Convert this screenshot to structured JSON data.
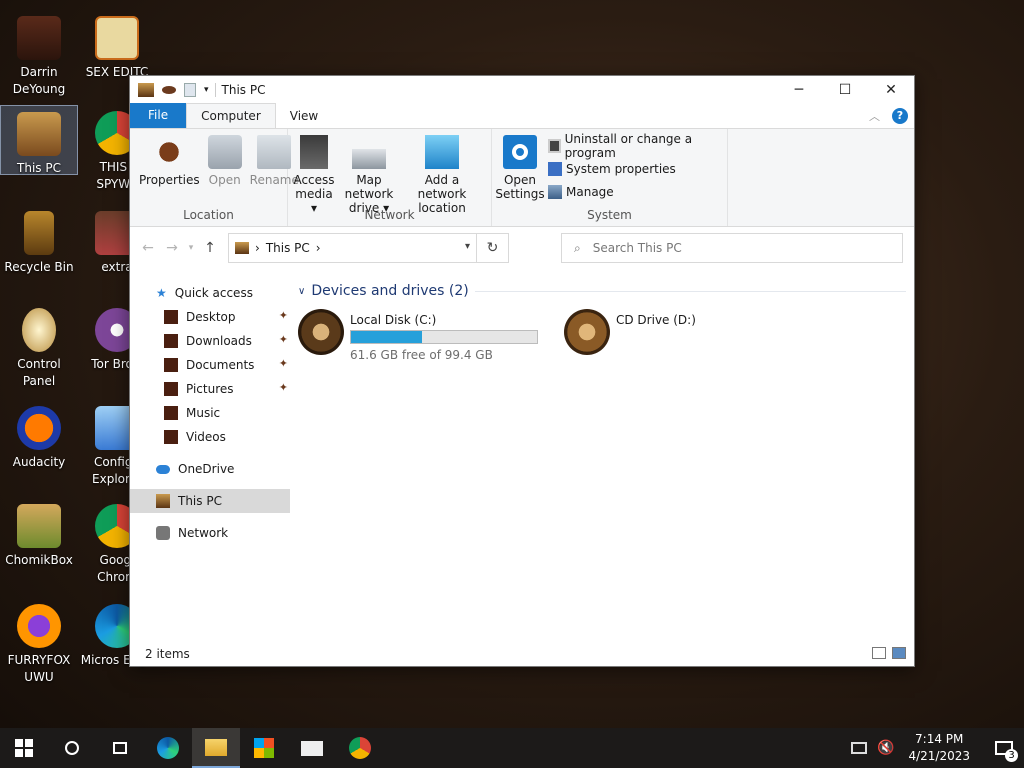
{
  "desktop": {
    "icons": [
      {
        "label": "Darrin DeYoung"
      },
      {
        "label": "SEX EDITC"
      },
      {
        "label": "This PC"
      },
      {
        "label": "THIS I SPYWA"
      },
      {
        "label": "Recycle Bin"
      },
      {
        "label": "extra"
      },
      {
        "label": "Control Panel"
      },
      {
        "label": "Tor Brow"
      },
      {
        "label": "Audacity"
      },
      {
        "label": "Configu Explorer"
      },
      {
        "label": "ChomikBox"
      },
      {
        "label": "Googl Chrom"
      },
      {
        "label": "FURRYFOX UWU"
      },
      {
        "label": "Micros Edge"
      }
    ]
  },
  "window": {
    "title": "This PC",
    "controls": {
      "minimize": "─",
      "maximize": "☐",
      "close": "✕"
    },
    "tabs": [
      {
        "label": "File"
      },
      {
        "label": "Computer"
      },
      {
        "label": "View"
      }
    ],
    "help": "?",
    "ribbon": {
      "location": {
        "label": "Location",
        "buttons": [
          {
            "label": "Properties"
          },
          {
            "label": "Open"
          },
          {
            "label": "Rename"
          }
        ]
      },
      "network": {
        "label": "Network",
        "buttons": [
          {
            "label": "Access media ▾"
          },
          {
            "label": "Map network drive ▾"
          },
          {
            "label": "Add a network location"
          }
        ]
      },
      "system": {
        "label": "System",
        "open_settings": "Open Settings",
        "items": [
          {
            "label": "Uninstall or change a program"
          },
          {
            "label": "System properties"
          },
          {
            "label": "Manage"
          }
        ]
      }
    },
    "address": {
      "crumb": "This PC",
      "separator": "›"
    },
    "search_placeholder": "Search This PC",
    "nav": {
      "quick_access": "Quick access",
      "items": [
        {
          "label": "Desktop",
          "pinned": true
        },
        {
          "label": "Downloads",
          "pinned": true
        },
        {
          "label": "Documents",
          "pinned": true
        },
        {
          "label": "Pictures",
          "pinned": true
        },
        {
          "label": "Music",
          "pinned": false
        },
        {
          "label": "Videos",
          "pinned": false
        }
      ],
      "onedrive": "OneDrive",
      "this_pc": "This PC",
      "network": "Network"
    },
    "content": {
      "group_title": "Devices and drives (2)",
      "drives": [
        {
          "name": "Local Disk (C:)",
          "free_text": "61.6 GB free of 99.4 GB",
          "used_fraction": 0.38
        },
        {
          "name": "CD Drive (D:)"
        }
      ]
    },
    "status": "2 items"
  },
  "taskbar": {
    "time": "7:14 PM",
    "date": "4/21/2023",
    "notifications": "3"
  },
  "colors": {
    "accent": "#1979ca",
    "progress": "#26a0da",
    "taskbar": "#1c1a19",
    "nav_selected": "#d9d9d9"
  }
}
